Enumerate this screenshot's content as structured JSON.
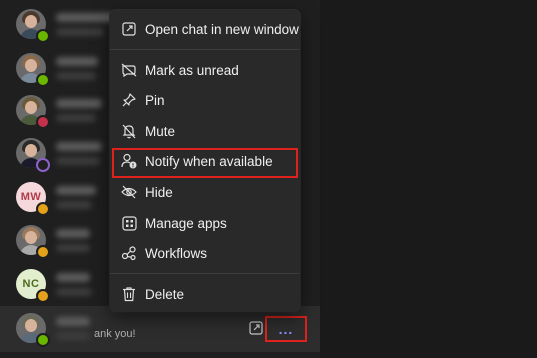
{
  "chat_list": {
    "rows": [
      {
        "avatar": "photo",
        "status": "available"
      },
      {
        "avatar": "photo",
        "status": "available"
      },
      {
        "avatar": "photo",
        "status": "busy"
      },
      {
        "avatar": "photo",
        "status": "offline"
      },
      {
        "avatar": "initials",
        "initials": "MW",
        "status": "away"
      },
      {
        "avatar": "photo",
        "status": "away"
      },
      {
        "avatar": "initials",
        "initials": "NC",
        "status": "away"
      },
      {
        "avatar": "photo",
        "status": "available",
        "preview_tail": "ank you!"
      }
    ]
  },
  "context_menu": {
    "items": [
      {
        "label": "Open chat in new window",
        "icon": "pop-out-icon"
      },
      {
        "label": "Mark as unread",
        "icon": "mark-unread-icon"
      },
      {
        "label": "Pin",
        "icon": "pin-icon"
      },
      {
        "label": "Mute",
        "icon": "mute-bell-icon"
      },
      {
        "label": "Notify when available",
        "icon": "notify-person-icon",
        "highlighted": true
      },
      {
        "label": "Hide",
        "icon": "hide-eye-icon"
      },
      {
        "label": "Manage apps",
        "icon": "apps-grid-icon"
      },
      {
        "label": "Workflows",
        "icon": "workflows-icon"
      },
      {
        "label": "Delete",
        "icon": "trash-icon"
      }
    ]
  },
  "more_options": {
    "label": "..."
  },
  "colors": {
    "highlight_border": "#e0221c",
    "accent": "#8b8fff",
    "status_available": "#6bb700",
    "status_busy": "#c4314b",
    "status_away": "#e3a21a"
  }
}
